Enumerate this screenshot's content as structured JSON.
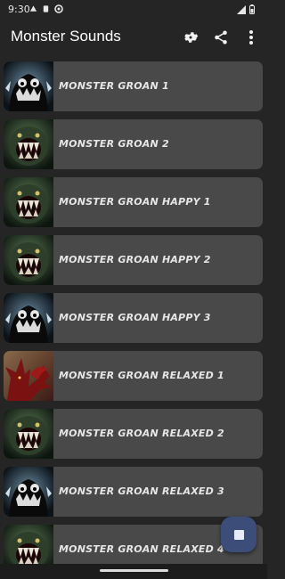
{
  "status": {
    "time": "9:30",
    "left_icons": [
      "notification-icon",
      "download-icon",
      "sync-icon"
    ],
    "right_icons": [
      "signal-icon",
      "battery-icon"
    ]
  },
  "app": {
    "title": "Monster Sounds",
    "actions": [
      "settings-icon",
      "share-icon",
      "more-vert-icon"
    ]
  },
  "sounds": [
    {
      "label": "MONSTER GROAN 1",
      "thumb": "dark-blob-monster"
    },
    {
      "label": "MONSTER GROAN 2",
      "thumb": "green-fanged-monster"
    },
    {
      "label": "MONSTER GROAN HAPPY 1",
      "thumb": "green-fanged-monster"
    },
    {
      "label": "MONSTER GROAN HAPPY 2",
      "thumb": "green-fanged-monster"
    },
    {
      "label": "MONSTER GROAN HAPPY 3",
      "thumb": "dark-blob-monster"
    },
    {
      "label": "MONSTER GROAN RELAXED 1",
      "thumb": "red-winged-monster"
    },
    {
      "label": "MONSTER GROAN RELAXED 2",
      "thumb": "green-fanged-monster"
    },
    {
      "label": "MONSTER GROAN RELAXED 3",
      "thumb": "dark-blob-monster"
    },
    {
      "label": "MONSTER GROAN RELAXED 4",
      "thumb": "green-fanged-monster"
    }
  ],
  "fab": {
    "icon": "stop-icon"
  },
  "colors": {
    "background": "#252525",
    "card": "#494949",
    "fab": "#3c4d7a",
    "text": "#e6e6e6"
  }
}
